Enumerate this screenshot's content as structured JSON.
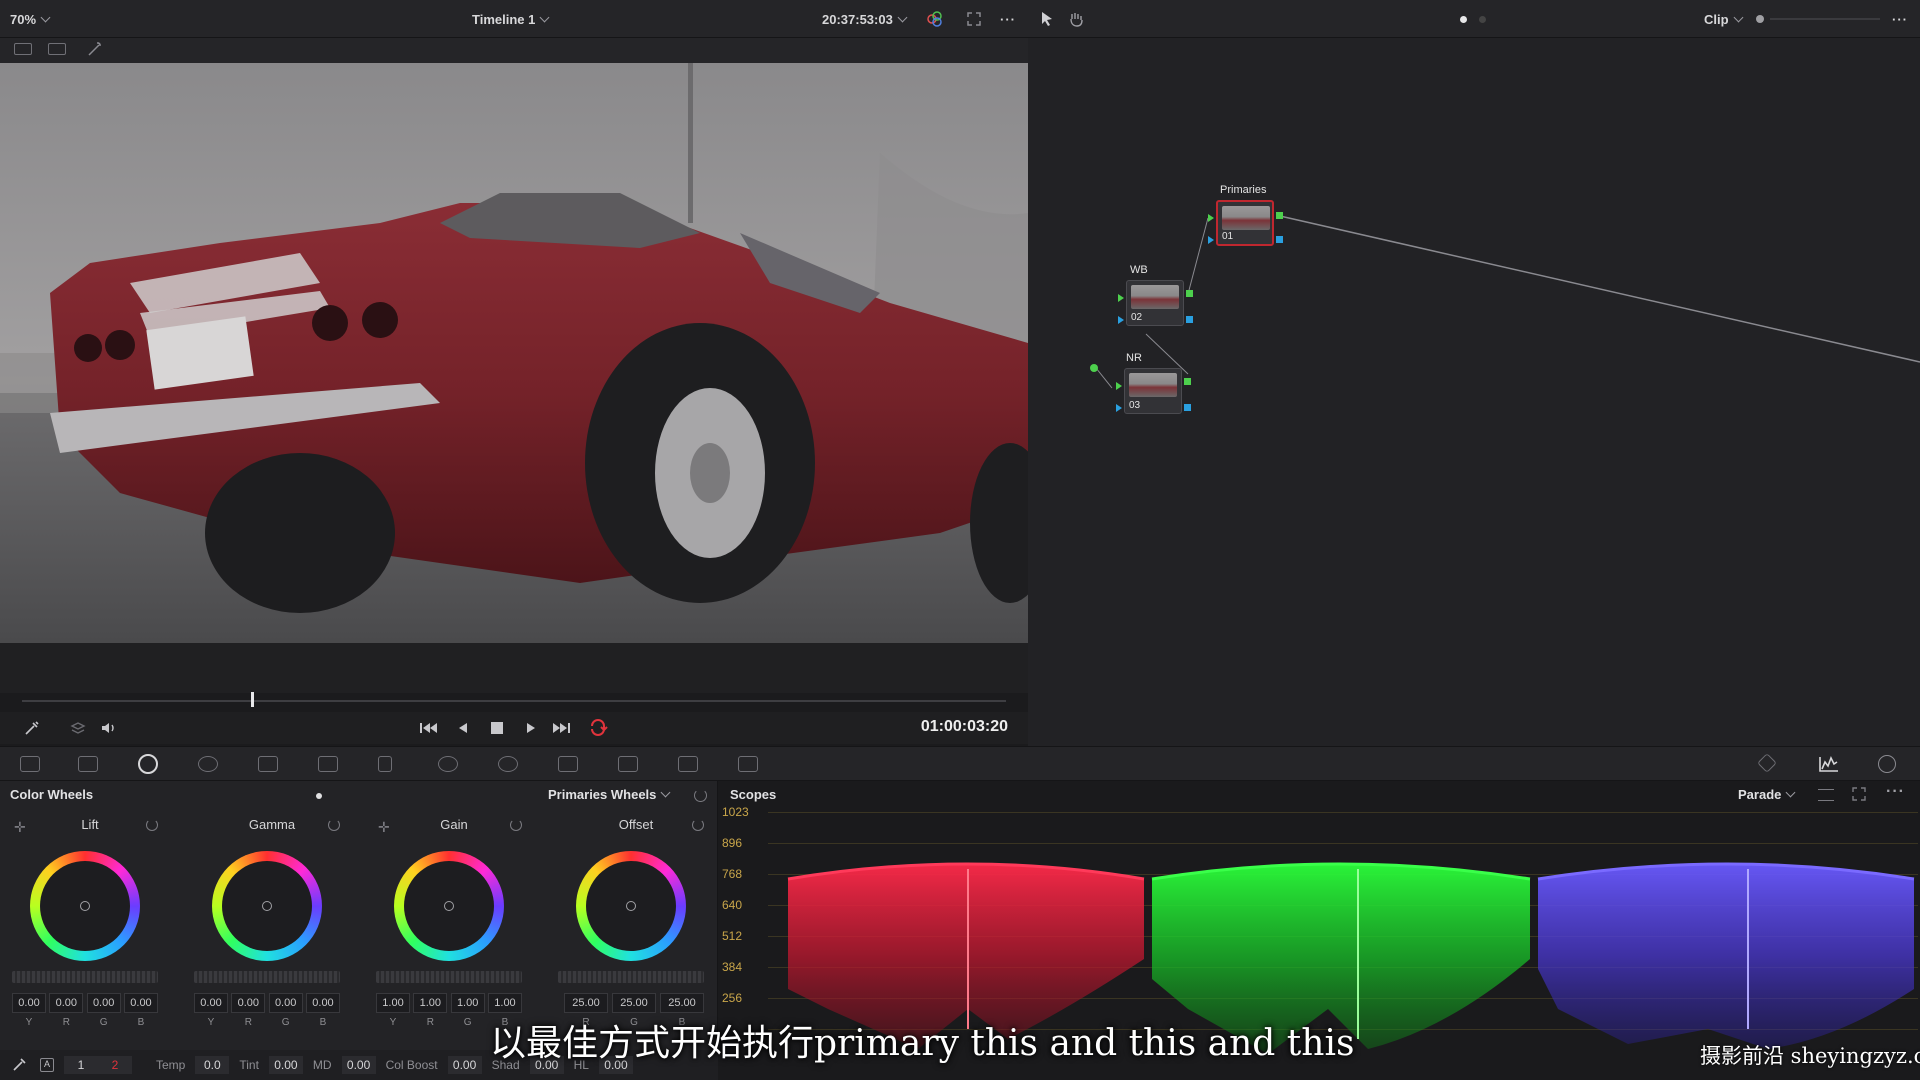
{
  "top_bar": {
    "zoom": "70%",
    "timeline_name": "Timeline 1",
    "timecode": "20:37:53:03",
    "mode": "Clip"
  },
  "viewer": {
    "timecode": "01:00:03:20",
    "playhead_fraction": 0.234
  },
  "nodes": [
    {
      "label": "Primaries",
      "number": "01"
    },
    {
      "label": "WB",
      "number": "02"
    },
    {
      "label": "NR",
      "number": "03"
    }
  ],
  "color_wheels": {
    "title": "Color Wheels",
    "mode": "Primaries Wheels",
    "wheels": [
      {
        "name": "Lift",
        "values": [
          "0.00",
          "0.00",
          "0.00",
          "0.00"
        ]
      },
      {
        "name": "Gamma",
        "values": [
          "0.00",
          "0.00",
          "0.00",
          "0.00"
        ]
      },
      {
        "name": "Gain",
        "values": [
          "1.00",
          "1.00",
          "1.00",
          "1.00"
        ]
      },
      {
        "name": "Offset",
        "values": [
          "25.00",
          "25.00",
          "25.00"
        ]
      }
    ],
    "channels_4": [
      "Y",
      "R",
      "G",
      "B"
    ],
    "channels_3": [
      "R",
      "G",
      "B"
    ]
  },
  "bottom_bar": {
    "page_1": "1",
    "page_2": "2",
    "temp_label": "Temp",
    "temp_value": "0.0",
    "tint_label": "Tint",
    "tint_value": "0.00",
    "md_label": "MD",
    "md_value": "0.00",
    "colboost_label": "Col Boost",
    "colboost_value": "0.00",
    "shad_label": "Shad",
    "shad_value": "0.00",
    "hl_label": "HL",
    "hl_value": "0.00"
  },
  "scopes": {
    "title": "Scopes",
    "mode": "Parade",
    "y_ticks": [
      "1023",
      "896",
      "768",
      "640",
      "512",
      "384",
      "256"
    ]
  },
  "subtitle": "以最佳方式开始执行primary this and this and this",
  "watermark": "摄影前沿 sheyingzyz.com",
  "colors": {
    "accent_red": "#e0333c",
    "parade_red": "#ff2a4a",
    "parade_green": "#2bff3a",
    "parade_blue": "#5a4aff",
    "node_selected": "#c0272f"
  }
}
